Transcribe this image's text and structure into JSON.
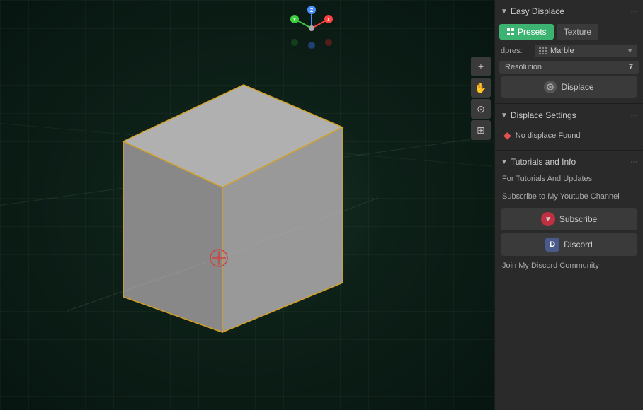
{
  "viewport": {
    "background_color": "#0d2018"
  },
  "gizmo": {
    "x_label": "X",
    "y_label": "Y",
    "z_label": "Z"
  },
  "toolbar": {
    "icons": [
      {
        "name": "add-icon",
        "symbol": "+"
      },
      {
        "name": "hand-icon",
        "symbol": "✋"
      },
      {
        "name": "camera-icon",
        "symbol": "🎥"
      },
      {
        "name": "grid-icon",
        "symbol": "⊞"
      }
    ]
  },
  "panel": {
    "easy_displace_section": {
      "title": "Easy Displace",
      "tabs": [
        {
          "id": "presets",
          "label": "Presets",
          "active": true
        },
        {
          "id": "texture",
          "label": "Texture",
          "active": false
        }
      ],
      "preset_label": "dpres:",
      "preset_icon": "grid-icon",
      "preset_value": "Marble",
      "resolution_label": "Resolution",
      "resolution_value": "7",
      "displace_button": "Displace"
    },
    "displace_settings_section": {
      "title": "Displace Settings",
      "no_displace_text": "No displace Found"
    },
    "tutorials_section": {
      "title": "Tutorials and Info",
      "for_tutorials_text": "For Tutorials And Updates",
      "subscribe_text": "Subscribe to My Youtube Channel",
      "subscribe_button": "Subscribe",
      "discord_button": "Discord",
      "join_text": "Join My Discord Community"
    }
  }
}
